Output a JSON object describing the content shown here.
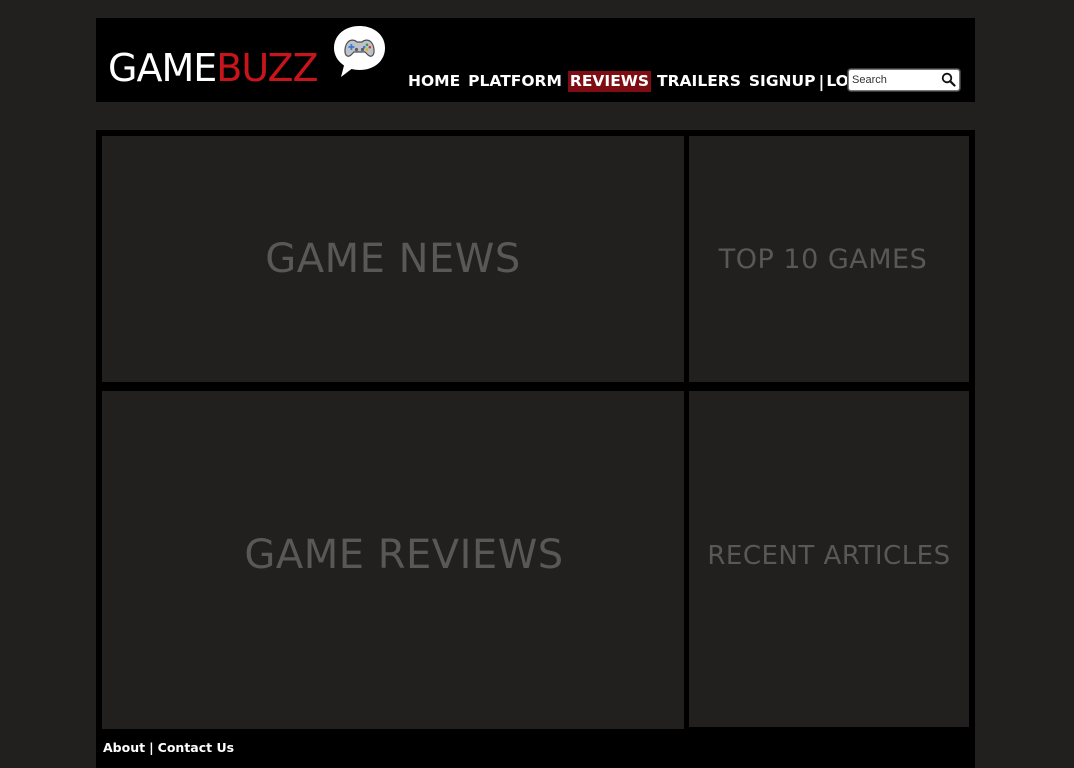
{
  "brand": {
    "name_part1": "GAME",
    "name_part2": "BUZZ",
    "logo_icon": "gamepad-speech-bubble",
    "accent_color": "#c8141b"
  },
  "nav": {
    "items": [
      {
        "label": "HOME",
        "active": false
      },
      {
        "label": "PLATFORM",
        "active": false
      },
      {
        "label": "REVIEWS",
        "active": true
      },
      {
        "label": "TRAILERS",
        "active": false
      },
      {
        "label": "SIGNUP",
        "active": false
      },
      {
        "label": "LOGIN",
        "active": false
      }
    ],
    "separator": "|",
    "active_color": "#7d0d12"
  },
  "search": {
    "placeholder": "Search",
    "icon": "search-icon"
  },
  "panels": {
    "game_news": "GAME NEWS",
    "top_games": "TOP 10 GAMES",
    "game_reviews": "GAME REVIEWS",
    "recent_articles": "RECENT ARTICLES"
  },
  "footer": {
    "about": "About",
    "separator": "|",
    "contact": "Contact Us"
  }
}
